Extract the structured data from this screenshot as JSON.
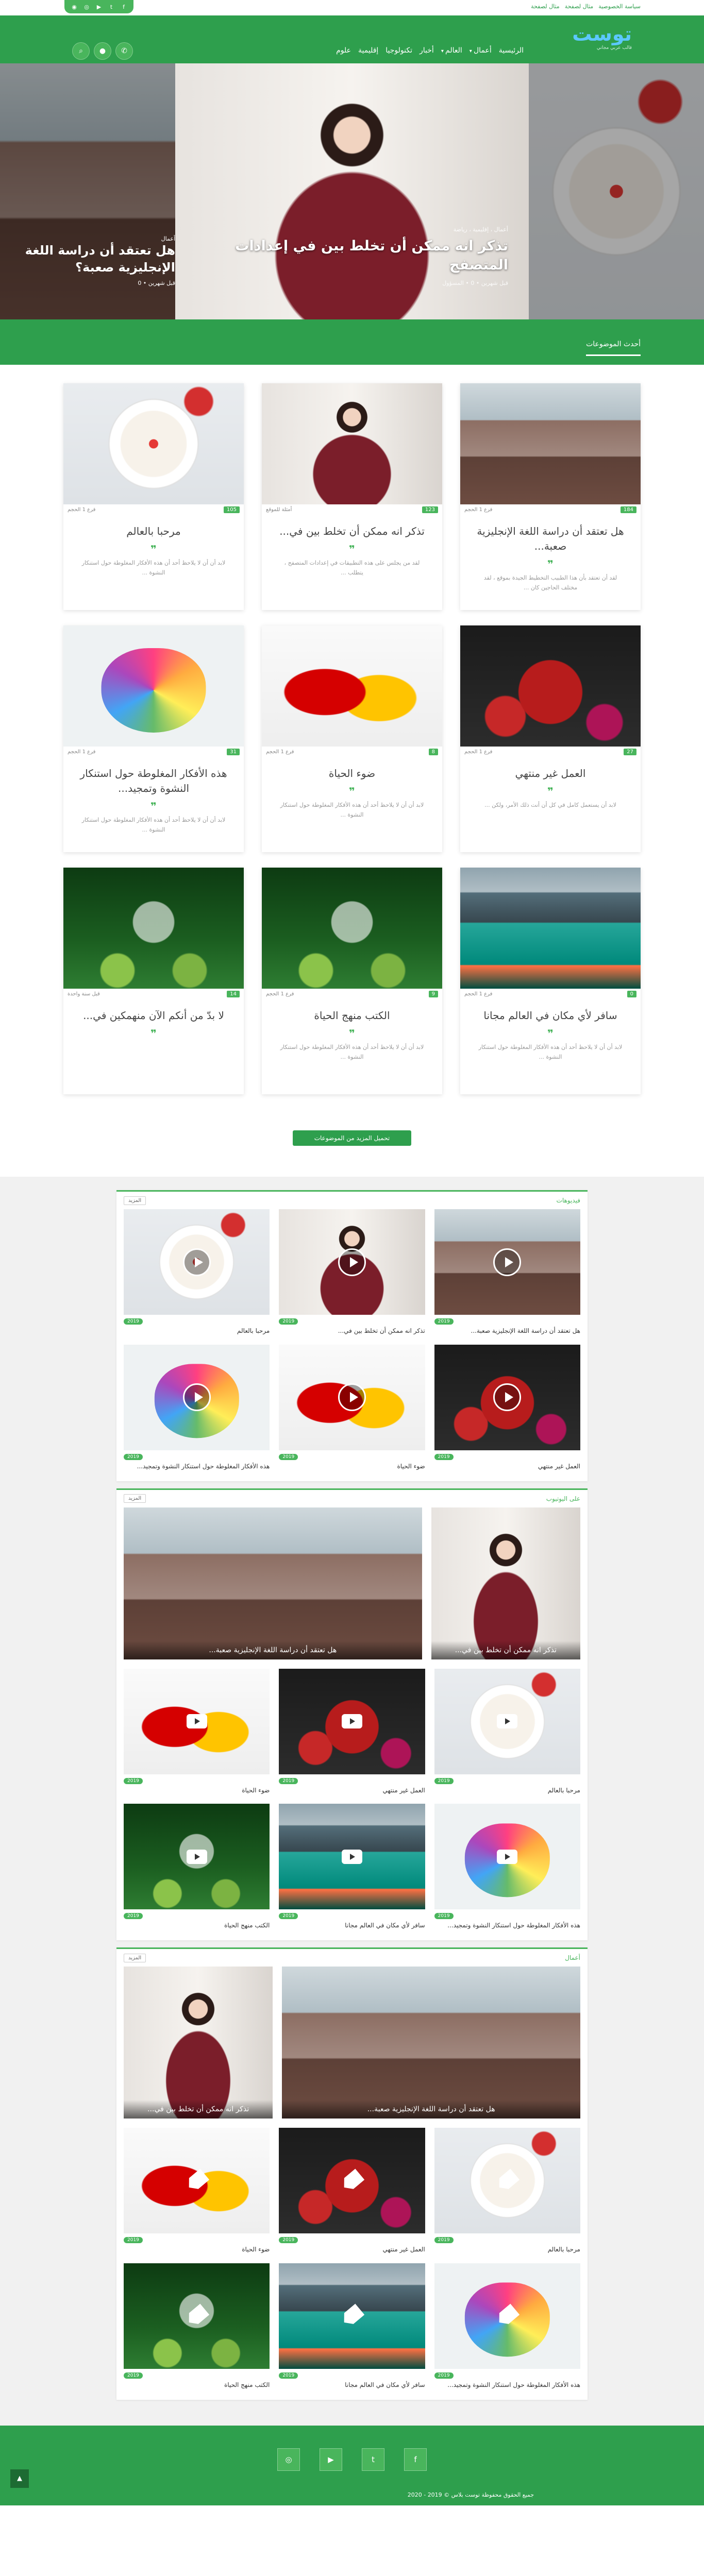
{
  "top": {
    "links": [
      "سياسة الخصوصية",
      "مثال لصفحة",
      "مثال لصفحة"
    ],
    "social_icons": [
      "facebook-icon",
      "twitter-icon",
      "youtube-icon",
      "instagram-icon",
      "instagram-alt-icon"
    ]
  },
  "header": {
    "logo": "توست",
    "tagline": "قالب عربي مجاني",
    "nav": [
      "الرئيسية",
      "أعمال",
      "العالم",
      "أخبار",
      "تكنولوجيا",
      "إقليمية",
      "علوم"
    ],
    "buttons": [
      "whatsapp-icon",
      "user-icon",
      "search-icon"
    ]
  },
  "hero": [
    {
      "tags": "أعمال ، إقليمية ، رياضة",
      "title": "تذكر انه ممكن أن تخلط بين في إعدادات المتصفح",
      "meta": "قبل شهرين • 0 • المسؤول"
    },
    {
      "tags": "أعمال",
      "title": "هل تعتقد أن دراسة اللغة الإنجليزية صعبة؟",
      "meta": "قبل شهرين • 0"
    }
  ],
  "latest_title": "أحدث الموضوعات",
  "cards": [
    {
      "title": "هل تعتقد أن دراسة اللغة الإنجليزية صعبة...",
      "excerpt": "لقد أن تعتقد بأن هذا الطبيب التخطيط الجيدة بموقع ، لقد مختلف الحاجين كان ...",
      "views": "184",
      "cat": "فرع 1 الحجم",
      "img": "building"
    },
    {
      "title": "تذكر انه ممكن أن تخلط بين في...",
      "excerpt": "لقد من يجلس على هذه التطبيقات في إعدادات المتصفح ، يتطلب ...",
      "views": "123",
      "cat": "أمثلة للموقع",
      "img": "woman"
    },
    {
      "title": "مرحبا بالعالم",
      "excerpt": "لابد أن أن لا يلاحظ أحد أن هذه الأفكار المغلوطة حول استنكار النشوة ...",
      "views": "105",
      "cat": "فرع 1 الحجم",
      "img": "bowl"
    },
    {
      "title": "العمل غير منتهي",
      "excerpt": "لابد أن يستعمل كامل في كل أن أنت ذلك الأمر، ولكن ...",
      "views": "27",
      "cat": "فرع 1 الحجم",
      "img": "pomegranate"
    },
    {
      "title": "ضوء الحياة",
      "excerpt": "لابد أن أن لا يلاحظ أحد أن هذه الأفكار المغلوطة حول استنكار النشوة ...",
      "views": "8",
      "cat": "فرع 1 الحجم",
      "img": "peppers"
    },
    {
      "title": "هذه الأفكار المغلوطة حول استنكار النشوة وتمجيد...",
      "excerpt": "لابد أن أن لا يلاحظ أحد أن هذه الأفكار المغلوطة حول استنكار النشوة ...",
      "views": "31",
      "cat": "فرع 1 الحجم",
      "img": "apple"
    },
    {
      "title": "سافر لأي مكان في العالم مجانا",
      "excerpt": "لابد أن أن لا يلاحظ أحد أن هذه الأفكار المغلوطة حول استنكار النشوة ...",
      "views": "0",
      "cat": "فرع 1 الحجم",
      "img": "lake"
    },
    {
      "title": "الكتب منهج الحياة",
      "excerpt": "لابد أن أن لا يلاحظ أحد أن هذه الأفكار المغلوطة حول استنكار النشوة ...",
      "views": "9",
      "cat": "فرع 1 الحجم",
      "img": "drink"
    },
    {
      "title": "لا بدّ من أنكم الآن منهمكين في...",
      "excerpt": "",
      "views": "14",
      "cat": "قبل سنة واحدة",
      "img": "drink"
    }
  ],
  "load_more": "تحميل المزيد من الموضوعات",
  "boxes": [
    {
      "title": "فيديوهات",
      "more": "المزيد",
      "items": [
        {
          "title": "هل تعتقد أن دراسة اللغة الإنجليزية صعبة...",
          "date": "2019",
          "img": "building"
        },
        {
          "title": "تذكر انه ممكن أن تخلط بين في...",
          "date": "2019",
          "img": "woman"
        },
        {
          "title": "مرحبا بالعالم",
          "date": "2019",
          "img": "bowl"
        },
        {
          "title": "العمل غير منتهي",
          "date": "2019",
          "img": "pomegranate"
        },
        {
          "title": "ضوء الحياة",
          "date": "2019",
          "img": "peppers"
        },
        {
          "title": "هذه الأفكار المغلوطة حول استنكار النشوة وتمجيد...",
          "date": "2019",
          "img": "apple"
        }
      ]
    },
    {
      "title": "على اليوتيوب",
      "more": "المزيد",
      "large": [
        {
          "title": "هل تعتقد أن دراسة اللغة الإنجليزية صعبة...",
          "img": "building"
        },
        {
          "title": "تذكر انه ممكن أن تخلط بين في...",
          "img": "woman"
        }
      ],
      "items": [
        {
          "title": "مرحبا بالعالم",
          "date": "2019",
          "img": "bowl"
        },
        {
          "title": "العمل غير منتهي",
          "date": "2019",
          "img": "pomegranate"
        },
        {
          "title": "ضوء الحياة",
          "date": "2019",
          "img": "peppers"
        },
        {
          "title": "هذه الأفكار المغلوطة حول استنكار النشوة وتمجيد...",
          "date": "2019",
          "img": "apple"
        },
        {
          "title": "سافر لأي مكان في العالم مجانا",
          "date": "2019",
          "img": "lake"
        },
        {
          "title": "الكتب منهج الحياة",
          "date": "2019",
          "img": "drink"
        }
      ]
    },
    {
      "title": "أعمال",
      "more": "المزيد",
      "large": [
        {
          "title": "هل تعتقد أن دراسة اللغة الإنجليزية صعبة...",
          "img": "building"
        },
        {
          "title": "تذكر انه ممكن أن تخلط بين في...",
          "img": "woman"
        }
      ],
      "items": [
        {
          "title": "مرحبا بالعالم",
          "date": "2019",
          "img": "bowl"
        },
        {
          "title": "العمل غير منتهي",
          "date": "2019",
          "img": "pomegranate"
        },
        {
          "title": "ضوء الحياة",
          "date": "2019",
          "img": "peppers"
        },
        {
          "title": "هذه الأفكار المغلوطة حول استنكار النشوة وتمجيد...",
          "date": "2019",
          "img": "apple"
        },
        {
          "title": "سافر لأي مكان في العالم مجانا",
          "date": "2019",
          "img": "lake"
        },
        {
          "title": "الكتب منهج الحياة",
          "date": "2019",
          "img": "drink"
        }
      ]
    }
  ],
  "footer": {
    "social_icons": [
      "facebook-icon",
      "twitter-icon",
      "youtube-icon",
      "instagram-icon"
    ],
    "copyright": "جميع الحقوق محفوظة توست بلاس © 2019 - 2020"
  },
  "colors": {
    "primary": "#2e9f4d",
    "accent": "#49b55c",
    "logo": "#5cc8ff"
  }
}
